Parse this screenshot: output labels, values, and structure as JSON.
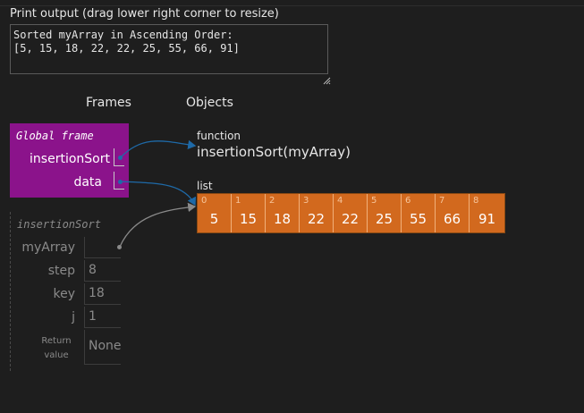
{
  "print_output": {
    "label": "Print output (drag lower right corner to resize)",
    "text": "Sorted myArray in Ascending Order:\n[5, 15, 18, 22, 22, 25, 55, 66, 91]"
  },
  "headers": {
    "frames": "Frames",
    "objects": "Objects"
  },
  "global_frame": {
    "title": "Global frame",
    "vars": [
      {
        "name": "insertionSort"
      },
      {
        "name": "data"
      }
    ]
  },
  "sort_frame": {
    "title": "insertionSort",
    "vars": [
      {
        "name": "myArray",
        "value": ""
      },
      {
        "name": "step",
        "value": "8"
      },
      {
        "name": "key",
        "value": "18"
      },
      {
        "name": "j",
        "value": "1"
      }
    ],
    "return_label": "Return value",
    "return_value": "None"
  },
  "function_obj": {
    "type_label": "function",
    "signature": "insertionSort(myArray)"
  },
  "list_obj": {
    "type_label": "list",
    "cells": [
      {
        "index": "0",
        "value": "5"
      },
      {
        "index": "1",
        "value": "15"
      },
      {
        "index": "2",
        "value": "18"
      },
      {
        "index": "3",
        "value": "22"
      },
      {
        "index": "4",
        "value": "22"
      },
      {
        "index": "5",
        "value": "25"
      },
      {
        "index": "6",
        "value": "55"
      },
      {
        "index": "7",
        "value": "66"
      },
      {
        "index": "8",
        "value": "91"
      }
    ]
  },
  "colors": {
    "background": "#1e1e1e",
    "global_frame": "#8b138b",
    "list_cell": "#d2691e",
    "pointer_active": "#1e6aa8",
    "pointer_inactive": "#8a8a8a"
  }
}
